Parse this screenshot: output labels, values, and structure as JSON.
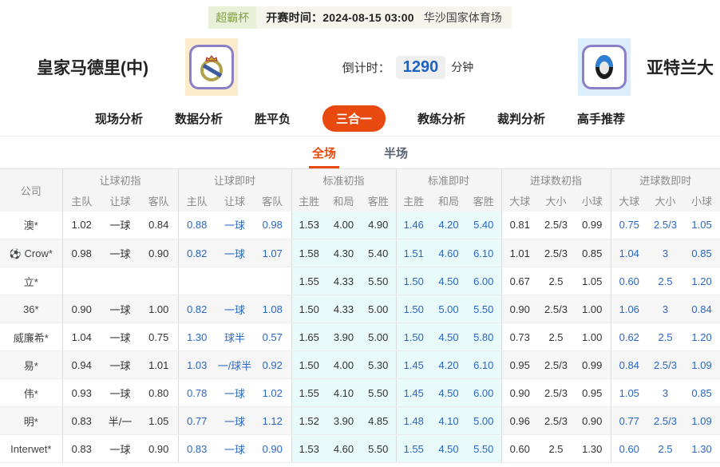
{
  "header": {
    "league_badge": "超霸杯",
    "kickoff": "开赛时间：2024-08-15 03:00",
    "venue": "华沙国家体育场",
    "home_team": "皇家马德里(中)",
    "away_team": "亚特兰大",
    "countdown_label": "倒计时：",
    "countdown_value": "1290",
    "countdown_unit": "分钟"
  },
  "nav": {
    "tabs": [
      {
        "label": "现场分析",
        "active": false
      },
      {
        "label": "数据分析",
        "active": false
      },
      {
        "label": "胜平负",
        "active": false
      },
      {
        "label": "三合一",
        "active": true
      },
      {
        "label": "教练分析",
        "active": false
      },
      {
        "label": "裁判分析",
        "active": false
      },
      {
        "label": "高手推荐",
        "active": false
      }
    ],
    "subtabs": [
      {
        "label": "全场",
        "active": true
      },
      {
        "label": "半场",
        "active": false
      }
    ]
  },
  "table": {
    "company_header": "公司",
    "groups": [
      {
        "label": "让球初指",
        "cols": [
          "主队",
          "让球",
          "客队"
        ]
      },
      {
        "label": "让球即时",
        "cols": [
          "主队",
          "让球",
          "客队"
        ]
      },
      {
        "label": "标准初指",
        "cols": [
          "主胜",
          "和局",
          "客胜"
        ]
      },
      {
        "label": "标准即时",
        "cols": [
          "主胜",
          "和局",
          "客胜"
        ]
      },
      {
        "label": "进球数初指",
        "cols": [
          "大球",
          "大小",
          "小球"
        ]
      },
      {
        "label": "进球数即时",
        "cols": [
          "大球",
          "大小",
          "小球"
        ]
      }
    ],
    "rows": [
      {
        "company": "澳*",
        "icon": false,
        "cells": [
          "1.02",
          "一球",
          "0.84",
          "0.88",
          "一球",
          "0.98",
          "1.53",
          "4.00",
          "4.90",
          "1.46",
          "4.20",
          "5.40",
          "0.81",
          "2.5/3",
          "0.99",
          "0.75",
          "2.5/3",
          "1.05"
        ]
      },
      {
        "company": "Crow*",
        "icon": true,
        "cells": [
          "0.98",
          "一球",
          "0.90",
          "0.82",
          "一球",
          "1.07",
          "1.58",
          "4.30",
          "5.40",
          "1.51",
          "4.60",
          "6.10",
          "1.01",
          "2.5/3",
          "0.85",
          "1.04",
          "3",
          "0.85"
        ]
      },
      {
        "company": "立*",
        "icon": false,
        "cells": [
          "",
          "",
          "",
          "",
          "",
          "",
          "1.55",
          "4.33",
          "5.50",
          "1.50",
          "4.50",
          "6.00",
          "0.67",
          "2.5",
          "1.05",
          "0.60",
          "2.5",
          "1.20"
        ]
      },
      {
        "company": "36*",
        "icon": false,
        "cells": [
          "0.90",
          "一球",
          "1.00",
          "0.82",
          "一球",
          "1.08",
          "1.50",
          "4.33",
          "5.00",
          "1.50",
          "5.00",
          "5.50",
          "0.90",
          "2.5/3",
          "1.00",
          "1.06",
          "3",
          "0.84"
        ]
      },
      {
        "company": "威廉希*",
        "icon": false,
        "cells": [
          "1.04",
          "一球",
          "0.75",
          "1.30",
          "球半",
          "0.57",
          "1.65",
          "3.90",
          "5.00",
          "1.50",
          "4.50",
          "5.80",
          "0.73",
          "2.5",
          "1.00",
          "0.62",
          "2.5",
          "1.20"
        ]
      },
      {
        "company": "易*",
        "icon": false,
        "cells": [
          "0.94",
          "一球",
          "1.01",
          "1.03",
          "一/球半",
          "0.92",
          "1.50",
          "4.00",
          "5.30",
          "1.45",
          "4.20",
          "6.10",
          "0.95",
          "2.5/3",
          "0.99",
          "0.84",
          "2.5/3",
          "1.09"
        ]
      },
      {
        "company": "伟*",
        "icon": false,
        "cells": [
          "0.93",
          "一球",
          "0.80",
          "0.78",
          "一球",
          "1.02",
          "1.55",
          "4.10",
          "5.50",
          "1.45",
          "4.50",
          "6.00",
          "0.90",
          "2.5/3",
          "0.95",
          "1.05",
          "3",
          "0.85"
        ]
      },
      {
        "company": "明*",
        "icon": false,
        "cells": [
          "0.83",
          "半/一",
          "1.05",
          "0.77",
          "一球",
          "1.12",
          "1.52",
          "3.90",
          "4.85",
          "1.48",
          "4.10",
          "5.00",
          "0.96",
          "2.5/3",
          "0.90",
          "0.77",
          "2.5/3",
          "1.09"
        ]
      },
      {
        "company": "Interwet*",
        "icon": false,
        "cells": [
          "0.83",
          "一球",
          "0.90",
          "0.83",
          "一球",
          "0.90",
          "1.53",
          "4.60",
          "5.50",
          "1.55",
          "4.50",
          "5.50",
          "0.60",
          "2.5",
          "1.30",
          "0.60",
          "2.5",
          "1.30"
        ]
      }
    ]
  },
  "colors": {
    "accent": "#e8490f",
    "live_blue": "#2a67c5",
    "badge_green": "#84a348",
    "standard_col_bg": "#e9fafb"
  }
}
